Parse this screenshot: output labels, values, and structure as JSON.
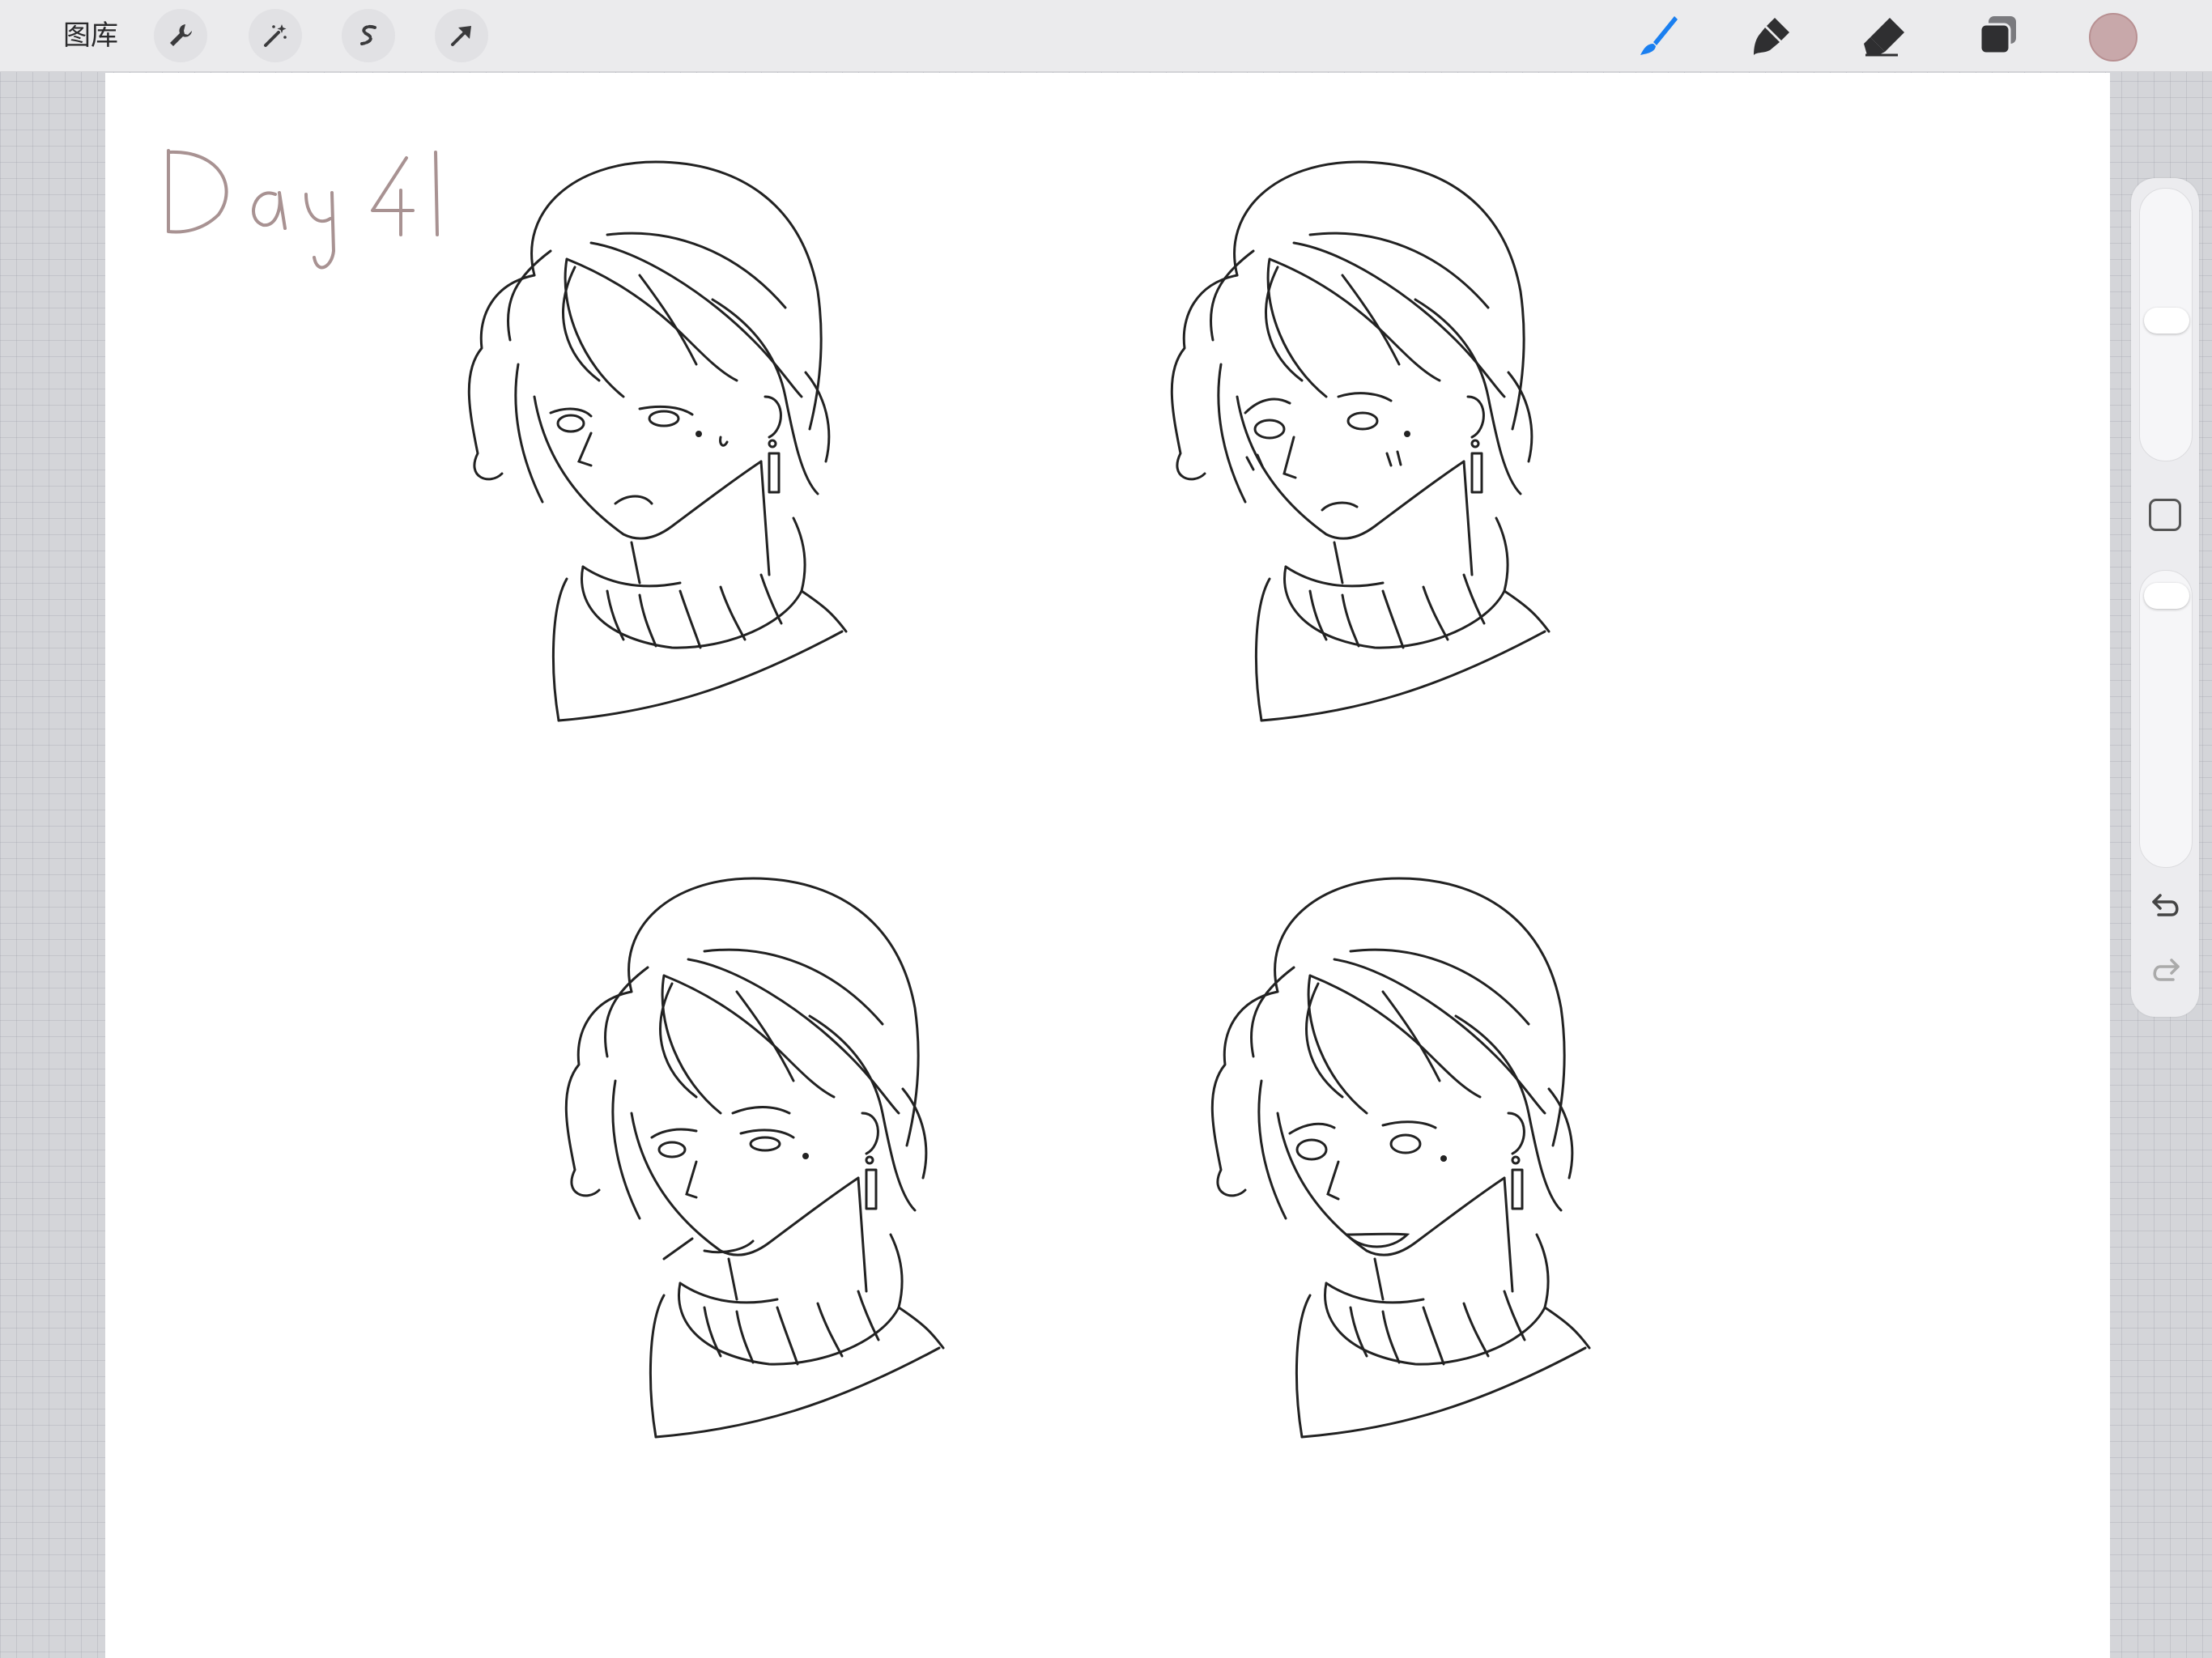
{
  "toolbar": {
    "gallery_label": "图库",
    "left_tools": [
      "wrench-icon",
      "magic-wand-icon",
      "selection-icon",
      "transform-arrow-icon"
    ],
    "right_tools": [
      "brush-icon",
      "smudge-icon",
      "eraser-icon",
      "layers-icon"
    ],
    "active_tool": "brush-icon",
    "active_color": "#c8a8aa",
    "accent_color": "#1a7ff0"
  },
  "canvas": {
    "handwritten_title": "Day 41",
    "title_color": "#a89292",
    "sketch_count": 4
  },
  "sidebar": {
    "controls": [
      "brush-size-slider",
      "modify-button",
      "opacity-slider",
      "undo-icon",
      "redo-icon"
    ]
  }
}
